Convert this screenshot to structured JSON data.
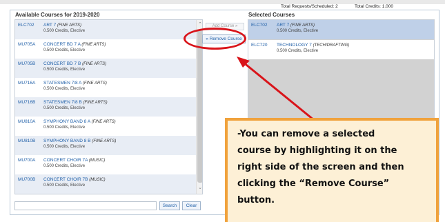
{
  "summary": {
    "total_requests_label": "Total Requests/Scheduled: 2",
    "total_credits_label": "Total Credits: 1.000"
  },
  "available": {
    "title": "Available Courses for 2019-2020",
    "courses": [
      {
        "code": "ELC702",
        "name": "ART 7",
        "dept": "(FINE ARTS)",
        "meta": "0.500 Credits,  Elective"
      },
      {
        "code": "MU705A",
        "name": "CONCERT BD 7 A",
        "dept": "(FINE ARTS)",
        "meta": "0.500 Credits,  Elective"
      },
      {
        "code": "MU705B",
        "name": "CONCERT BD 7 B",
        "dept": "(FINE ARTS)",
        "meta": "0.500 Credits,  Elective"
      },
      {
        "code": "MU716A",
        "name": "STATESMEN 7/8 A",
        "dept": "(FINE ARTS)",
        "meta": "0.500 Credits,  Elective"
      },
      {
        "code": "MU716B",
        "name": "STATESMEN 7/8 B",
        "dept": "(FINE ARTS)",
        "meta": "0.500 Credits,  Elective"
      },
      {
        "code": "MU810A",
        "name": "SYMPHONY BAND 8 A",
        "dept": "(FINE ARTS)",
        "meta": "0.500 Credits,  Elective"
      },
      {
        "code": "MU810B",
        "name": "SYMPHONY BAND 8 B",
        "dept": "(FINE ARTS)",
        "meta": "0.500 Credits,  Elective"
      },
      {
        "code": "MU700A",
        "name": "CONCERT CHOIR 7A",
        "dept": "(MUSIC)",
        "meta": "0.500 Credits,  Elective"
      },
      {
        "code": "MU700B",
        "name": "CONCERT CHOIR 7B",
        "dept": "(MUSIC)",
        "meta": "0.500 Credits,  Elective"
      }
    ]
  },
  "buttons": {
    "add_course": "Add Course »",
    "remove_course": "« Remove Course",
    "search": "Search",
    "clear": "Clear"
  },
  "selected": {
    "title": "Selected Courses",
    "courses": [
      {
        "code": "ELC702",
        "name": "ART 7",
        "dept": "(FINE ARTS)",
        "meta": "0.500 Credits,  Elective"
      },
      {
        "code": "ELC720",
        "name": "TECHNOLOGY 7",
        "dept": "(TECH/DRAFTING)",
        "meta": "0.500 Credits,  Elective"
      }
    ]
  },
  "search": {
    "value": ""
  },
  "callout": {
    "lines": [
      "-You can remove a selected",
      "course by highlighting it on the",
      "right side of the screen and then",
      "clicking the “Remove Course”",
      "button."
    ]
  },
  "colors": {
    "accent": "#1f5fa8",
    "annotation_red": "#d9141a",
    "callout_border": "#f0a23c",
    "callout_fill": "#fdf0d6",
    "selected_highlight": "#bfd0e8"
  }
}
